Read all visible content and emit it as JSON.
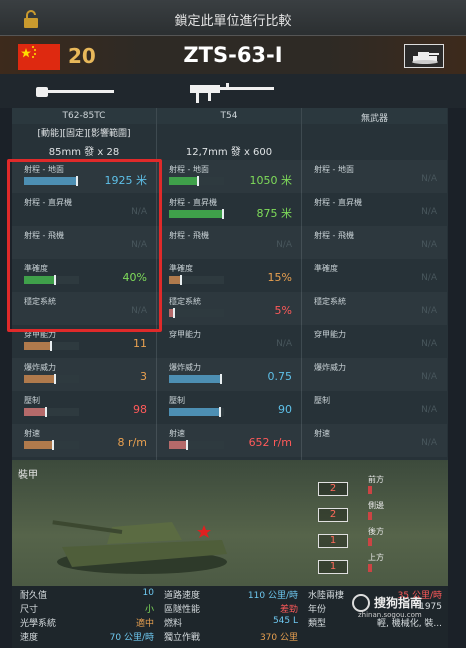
{
  "header": {
    "lock_title": "鎖定此單位進行比較"
  },
  "unit": {
    "tier": "20",
    "name": "ZTS-63-I",
    "nation_flag": "china-flag-icon",
    "type_icon": "tank-icon"
  },
  "weapons": [
    {
      "name": "T62-85TC",
      "tags": "[動能][固定][影響範圍]",
      "ammo": "85mm 發 x 28",
      "stats": [
        {
          "label": "射程 - 地面",
          "value": "1925 米",
          "fill": 0.95,
          "color": "#4d8fb3",
          "val_color": "#5ec0e8"
        },
        {
          "label": "射程 - 直昇機",
          "value": "N/A",
          "fill": 0,
          "color": "",
          "val_color": ""
        },
        {
          "label": "射程 - 飛機",
          "value": "N/A",
          "fill": 0,
          "color": "",
          "val_color": ""
        },
        {
          "label": "準確度",
          "value": "40%",
          "fill": 0.55,
          "color": "#3fa04a",
          "val_color": "#7fdc5a"
        },
        {
          "label": "穩定系統",
          "value": "N/A",
          "fill": 0,
          "color": "",
          "val_color": ""
        },
        {
          "label": "穿甲能力",
          "value": "11",
          "fill": 0.48,
          "color": "#b07a4c",
          "val_color": "#e8a050"
        },
        {
          "label": "爆炸威力",
          "value": "3",
          "fill": 0.55,
          "color": "#b07a4c",
          "val_color": "#e8a050"
        },
        {
          "label": "壓制",
          "value": "98",
          "fill": 0.38,
          "color": "#b56a6a",
          "val_color": "#ff5a5a"
        },
        {
          "label": "射速",
          "value": "8 r/m",
          "fill": 0.5,
          "color": "#b07a4c",
          "val_color": "#e8a050"
        }
      ]
    },
    {
      "name": "T54",
      "tags": "",
      "ammo": "12,7mm 發 x 600",
      "stats": [
        {
          "label": "射程 - 地面",
          "value": "1050 米",
          "fill": 0.5,
          "color": "#3fa04a",
          "val_color": "#7fdc5a"
        },
        {
          "label": "射程 - 直昇機",
          "value": "875 米",
          "fill": 0.96,
          "color": "#3fa04a",
          "val_color": "#7fdc5a"
        },
        {
          "label": "射程 - 飛機",
          "value": "N/A",
          "fill": 0,
          "color": "",
          "val_color": ""
        },
        {
          "label": "準確度",
          "value": "15%",
          "fill": 0.2,
          "color": "#b07a4c",
          "val_color": "#e8a050"
        },
        {
          "label": "穩定系統",
          "value": "5%",
          "fill": 0.08,
          "color": "#b56a6a",
          "val_color": "#ff5a5a"
        },
        {
          "label": "穿甲能力",
          "value": "N/A",
          "fill": 0,
          "color": "",
          "val_color": ""
        },
        {
          "label": "爆炸威力",
          "value": "0.75",
          "fill": 0.92,
          "color": "#4d8fb3",
          "val_color": "#5ec0e8"
        },
        {
          "label": "壓制",
          "value": "90",
          "fill": 0.9,
          "color": "#4d8fb3",
          "val_color": "#5ec0e8"
        },
        {
          "label": "射速",
          "value": "652 r/m",
          "fill": 0.3,
          "color": "#b56a6a",
          "val_color": "#ff5a5a"
        }
      ]
    },
    {
      "name": "無武器",
      "tags": "",
      "ammo": "",
      "stats": [
        {
          "label": "射程 - 地面",
          "value": "N/A",
          "fill": 0,
          "color": "",
          "val_color": ""
        },
        {
          "label": "射程 - 直昇機",
          "value": "N/A",
          "fill": 0,
          "color": "",
          "val_color": ""
        },
        {
          "label": "射程 - 飛機",
          "value": "N/A",
          "fill": 0,
          "color": "",
          "val_color": ""
        },
        {
          "label": "準確度",
          "value": "N/A",
          "fill": 0,
          "color": "",
          "val_color": ""
        },
        {
          "label": "穩定系統",
          "value": "N/A",
          "fill": 0,
          "color": "",
          "val_color": ""
        },
        {
          "label": "穿甲能力",
          "value": "N/A",
          "fill": 0,
          "color": "",
          "val_color": ""
        },
        {
          "label": "爆炸威力",
          "value": "N/A",
          "fill": 0,
          "color": "",
          "val_color": ""
        },
        {
          "label": "壓制",
          "value": "N/A",
          "fill": 0,
          "color": "",
          "val_color": ""
        },
        {
          "label": "射速",
          "value": "N/A",
          "fill": 0,
          "color": "",
          "val_color": ""
        }
      ]
    }
  ],
  "armor": {
    "title": "裝甲",
    "entries": [
      {
        "label": "前方",
        "value": "2"
      },
      {
        "label": "側邊",
        "value": "2"
      },
      {
        "label": "後方",
        "value": "1"
      },
      {
        "label": "上方",
        "value": "1"
      }
    ]
  },
  "details": {
    "durability_label": "耐久值",
    "durability_value": "10",
    "size_label": "尺寸",
    "size_value": "小",
    "optics_label": "光學系統",
    "optics_value": "適中",
    "speed_label": "速度",
    "speed_value": "70 公里/時",
    "road_speed_label": "道路速度",
    "road_speed_value": "110 公里/時",
    "terrain_label": "區隧性能",
    "terrain_value": "差勁",
    "fuel_label": "燃料",
    "fuel_value": "545 L",
    "autonomy_label": "獨立作戰",
    "autonomy_value": "370 公里",
    "water_label": "水陸兩棲",
    "water_value": "35 公里/時",
    "year_label": "年份",
    "year_value": "1975",
    "category_label": "類型",
    "category_value": "輕, 機械化, 裝..."
  },
  "watermark": {
    "text": "搜狗指南",
    "url": "zhinan.sogou.com"
  }
}
